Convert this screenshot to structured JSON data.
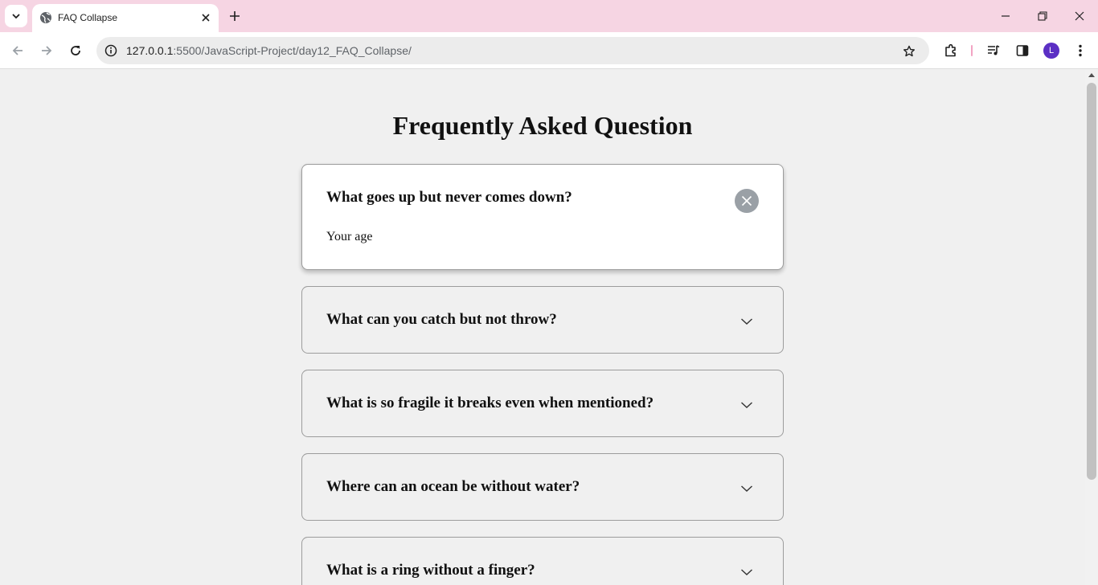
{
  "browser": {
    "tab_title": "FAQ Collapse",
    "url_host": "127.0.0.1",
    "url_rest": ":5500/JavaScript-Project/day12_FAQ_Collapse/",
    "profile_initial": "L",
    "tabstrip_color": "#f6d5e3",
    "profile_color": "#5b2fc4"
  },
  "page": {
    "title": "Frequently Asked Question",
    "background": "#f0f0f0",
    "faqs": [
      {
        "question": "What goes up but never comes down?",
        "answer": "Your age",
        "expanded": true,
        "icon": "close-icon"
      },
      {
        "question": "What can you catch but not throw?",
        "expanded": false,
        "icon": "chevron-down-icon"
      },
      {
        "question": "What is so fragile it breaks even when mentioned?",
        "expanded": false,
        "icon": "chevron-down-icon"
      },
      {
        "question": "Where can an ocean be without water?",
        "expanded": false,
        "icon": "chevron-down-icon"
      },
      {
        "question": "What is a ring without a finger?",
        "expanded": false,
        "icon": "chevron-down-icon"
      }
    ]
  }
}
